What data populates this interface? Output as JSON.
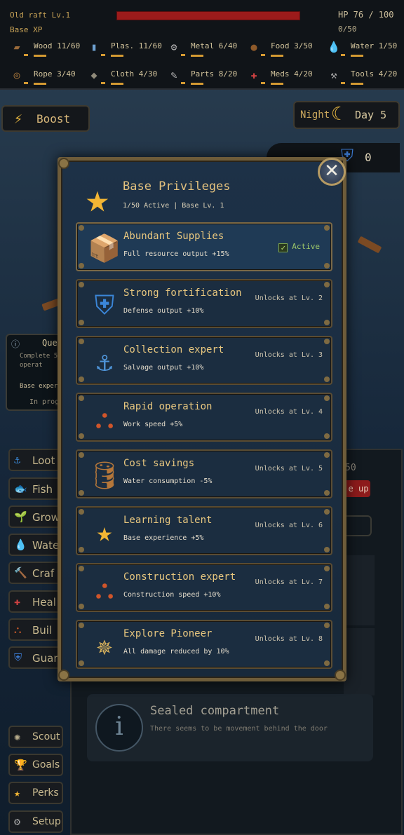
{
  "topbar": {
    "raft_name": "Old raft Lv.1",
    "base_xp_label": "Base XP",
    "hp_text": "HP 76 / 100",
    "hp_fraction": 0.76,
    "xp_text": "0/50",
    "resources": [
      {
        "label": "Wood 11/60",
        "icon": "log-icon",
        "glyph": "▰",
        "color": "#9a6a3a"
      },
      {
        "label": "Plas. 11/60",
        "icon": "bottle-icon",
        "glyph": "▮",
        "color": "#6ea0cf"
      },
      {
        "label": "Metal 6/40",
        "icon": "gear-icon",
        "glyph": "⚙",
        "color": "#a9a9a9"
      },
      {
        "label": "Food 3/50",
        "icon": "meat-icon",
        "glyph": "●",
        "color": "#8e5a2a"
      },
      {
        "label": "Water 1/50",
        "icon": "water-drop-icon",
        "glyph": "💧",
        "color": "#3a8ad8"
      },
      {
        "label": "Rope 3/40",
        "icon": "rope-icon",
        "glyph": "◎",
        "color": "#a7753a"
      },
      {
        "label": "Cloth 4/30",
        "icon": "cloth-icon",
        "glyph": "◆",
        "color": "#8f8a7a"
      },
      {
        "label": "Parts 8/20",
        "icon": "wrench-parts-icon",
        "glyph": "✎",
        "color": "#b5b5b5"
      },
      {
        "label": "Meds 4/20",
        "icon": "medkit-icon",
        "glyph": "✚",
        "color": "#d04242"
      },
      {
        "label": "Tools 4/20",
        "icon": "wrench-icon",
        "glyph": "⚒",
        "color": "#aaaaaa"
      }
    ]
  },
  "hud": {
    "boost_label": "Boost",
    "night_label": "Night",
    "day_label": "Day 5",
    "shield_value": "0"
  },
  "quest": {
    "title": "Que",
    "desc_line1": "Complete 5",
    "desc_line2": "operat",
    "base_label": "Base exper",
    "progress": "In prog"
  },
  "side_buttons": [
    {
      "label": "Loot",
      "icon": "anchor-icon",
      "glyph": "⚓",
      "color": "#3a8ad8"
    },
    {
      "label": "Fish",
      "icon": "fish-icon",
      "glyph": "🐟",
      "color": "#3a8ad8"
    },
    {
      "label": "Grow",
      "icon": "sprout-icon",
      "glyph": "🌱",
      "color": "#5aa84a"
    },
    {
      "label": "Wate",
      "icon": "water-drop-icon",
      "glyph": "💧",
      "color": "#3a8ad8"
    },
    {
      "label": "Craf",
      "icon": "hammer-icon",
      "glyph": "🔨",
      "color": "#c9a65c"
    },
    {
      "label": "Heal",
      "icon": "medkit-icon",
      "glyph": "✚",
      "color": "#d04242"
    },
    {
      "label": "Buil",
      "icon": "scaffold-icon",
      "glyph": "⛬",
      "color": "#c0562a"
    },
    {
      "label": "Guar",
      "icon": "shield-icon",
      "glyph": "⛨",
      "color": "#3b7ad1"
    },
    {
      "label": "Scout",
      "icon": "compass-icon",
      "glyph": "✺",
      "color": "#b9ad8c"
    },
    {
      "label": "Goals",
      "icon": "trophy-icon",
      "glyph": "🏆",
      "color": "#e2b340"
    },
    {
      "label": "Perks",
      "icon": "star-icon",
      "glyph": "★",
      "color": "#f2b534"
    },
    {
      "label": "Setup",
      "icon": "gear-icon",
      "glyph": "⚙",
      "color": "#a9a9a9"
    }
  ],
  "right_panel": {
    "value": "50",
    "up_label": "e up"
  },
  "sealed": {
    "title": "Sealed compartment",
    "desc": "There seems to be movement behind the door",
    "icon_glyph": "i"
  },
  "modal": {
    "title": "Base Privileges",
    "active_count": "1/50 Active",
    "separator": "|",
    "base_level": "Base Lv. 1",
    "close_glyph": "✕",
    "star_glyph": "★",
    "privileges": [
      {
        "name": "Abundant Supplies",
        "desc": "Full resource output +15%",
        "status": "Active",
        "active": true,
        "icon": "supply-crate-icon",
        "glyph": "📦",
        "color": "#b98a4a"
      },
      {
        "name": "Strong fortification",
        "desc": "Defense output +10%",
        "status": "Unlocks at Lv. 2",
        "active": false,
        "icon": "shield-icon",
        "glyph": "⛨",
        "color": "#3b86d8"
      },
      {
        "name": "Collection expert",
        "desc": "Salvage output +10%",
        "status": "Unlocks at Lv. 3",
        "active": false,
        "icon": "anchor-icon",
        "glyph": "⚓",
        "color": "#4f95d9"
      },
      {
        "name": "Rapid operation",
        "desc": "Work speed +5%",
        "status": "Unlocks at Lv. 4",
        "active": false,
        "icon": "scaffold-icon",
        "glyph": "⛬",
        "color": "#d0552a"
      },
      {
        "name": "Cost savings",
        "desc": "Water consumption -5%",
        "status": "Unlocks at Lv. 5",
        "active": false,
        "icon": "barrel-icon",
        "glyph": "🛢",
        "color": "#b5773a"
      },
      {
        "name": "Learning talent",
        "desc": "Base experience +5%",
        "status": "Unlocks at Lv. 6",
        "active": false,
        "icon": "star-icon",
        "glyph": "★",
        "color": "#f2b534"
      },
      {
        "name": "Construction expert",
        "desc": "Construction speed +10%",
        "status": "Unlocks at Lv. 7",
        "active": false,
        "icon": "scaffold-icon",
        "glyph": "⛬",
        "color": "#d0552a"
      },
      {
        "name": "Explore Pioneer",
        "desc": "All damage reduced by 10%",
        "status": "Unlocks at Lv. 8",
        "active": false,
        "icon": "compass-icon",
        "glyph": "✵",
        "color": "#d8b25c"
      }
    ]
  }
}
